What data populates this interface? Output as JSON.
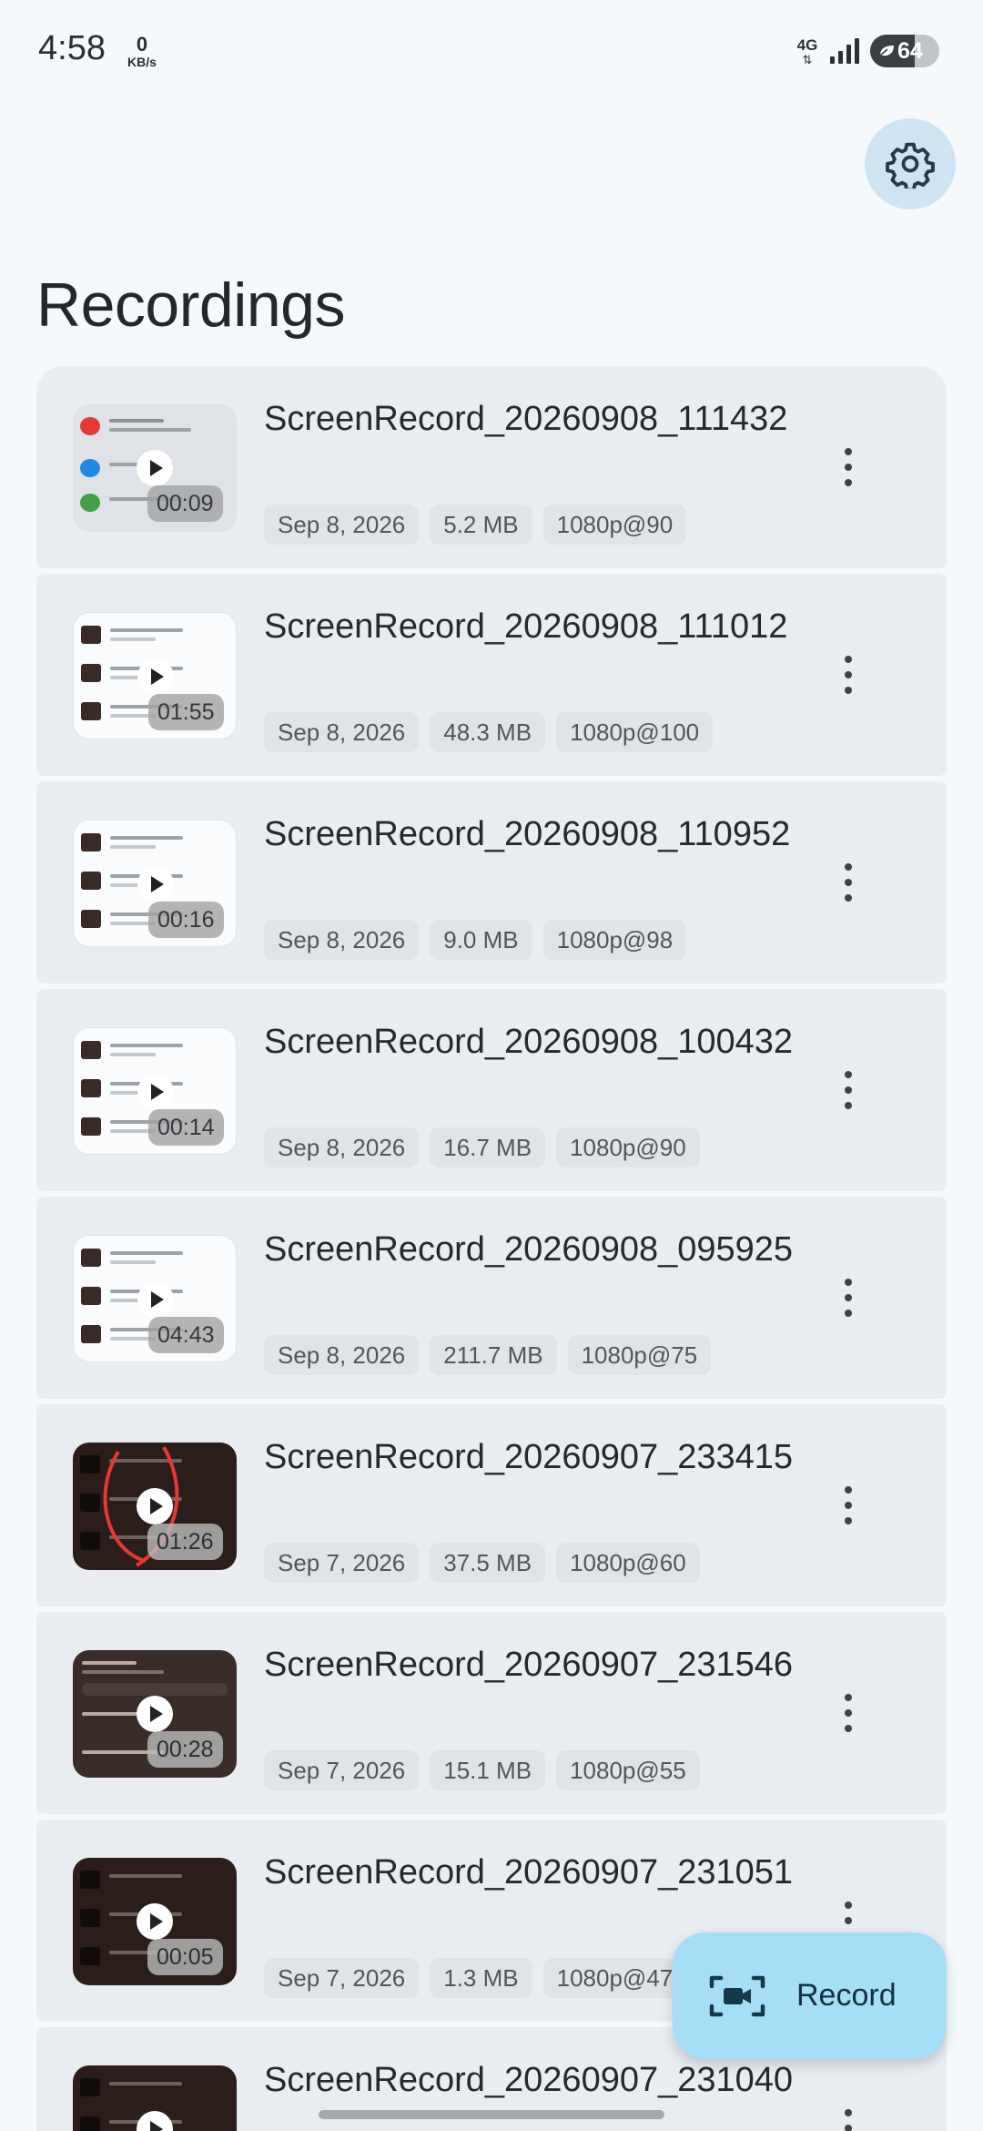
{
  "status_bar": {
    "time": "4:58",
    "net_speed_value": "0",
    "net_speed_unit": "KB/s",
    "network_type": "4G",
    "battery_level": "64",
    "icons": [
      "signal-icon",
      "battery-saver-icon"
    ]
  },
  "header": {
    "settings_icon": "gear-icon",
    "title": "Recordings"
  },
  "recordings": [
    {
      "name": "ScreenRecord_20260908_111432",
      "date": "Sep 8, 2026",
      "size": "5.2 MB",
      "quality": "1080p@90",
      "duration": "00:09",
      "thumb_style": "light-notification"
    },
    {
      "name": "ScreenRecord_20260908_111012",
      "date": "Sep 8, 2026",
      "size": "48.3 MB",
      "quality": "1080p@100",
      "duration": "01:55",
      "thumb_style": "light-list"
    },
    {
      "name": "ScreenRecord_20260908_110952",
      "date": "Sep 8, 2026",
      "size": "9.0 MB",
      "quality": "1080p@98",
      "duration": "00:16",
      "thumb_style": "light-list"
    },
    {
      "name": "ScreenRecord_20260908_100432",
      "date": "Sep 8, 2026",
      "size": "16.7 MB",
      "quality": "1080p@90",
      "duration": "00:14",
      "thumb_style": "light-list"
    },
    {
      "name": "ScreenRecord_20260908_095925",
      "date": "Sep 8, 2026",
      "size": "211.7 MB",
      "quality": "1080p@75",
      "duration": "04:43",
      "thumb_style": "light-list"
    },
    {
      "name": "ScreenRecord_20260907_233415",
      "date": "Sep 7, 2026",
      "size": "37.5 MB",
      "quality": "1080p@60",
      "duration": "01:26",
      "thumb_style": "dark-annotated"
    },
    {
      "name": "ScreenRecord_20260907_231546",
      "date": "Sep 7, 2026",
      "size": "15.1 MB",
      "quality": "1080p@55",
      "duration": "00:28",
      "thumb_style": "dark-settings"
    },
    {
      "name": "ScreenRecord_20260907_231051",
      "date": "Sep 7, 2026",
      "size": "1.3 MB",
      "quality": "1080p@47",
      "duration": "00:05",
      "thumb_style": "dark-list"
    },
    {
      "name": "ScreenRecord_20260907_231040",
      "date": "",
      "size": "",
      "quality": "",
      "duration": "",
      "thumb_style": "dark-list"
    }
  ],
  "fab": {
    "label": "Record",
    "icon": "screen-record-icon",
    "color": "#a6def8"
  },
  "colors": {
    "background": "#f6f9fc",
    "card": "#e9edf1",
    "chip": "#dfe4e8",
    "settings_button": "#cfe4f3"
  }
}
